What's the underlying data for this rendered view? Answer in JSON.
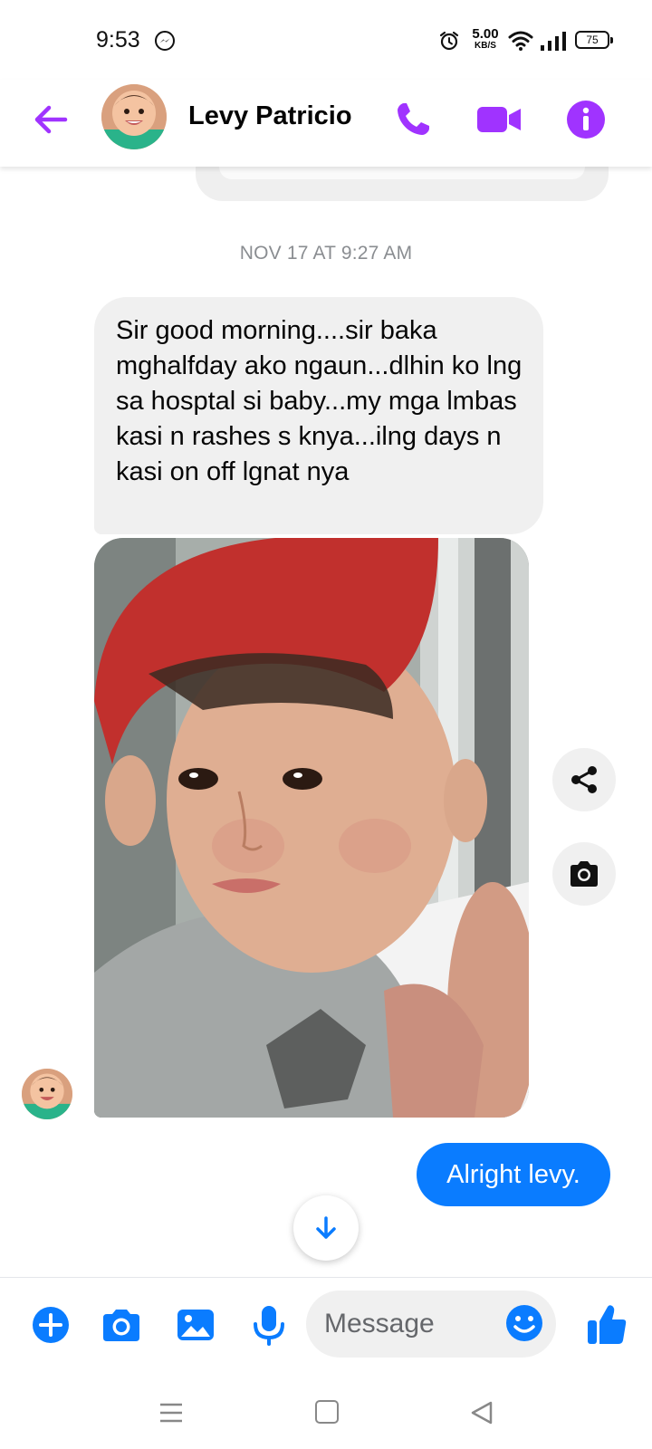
{
  "status_bar": {
    "time": "9:53",
    "net_speed_value": "5.00",
    "net_speed_unit": "KB/S",
    "battery": "75"
  },
  "header": {
    "contact_name": "Levy Patricio"
  },
  "conversation": {
    "timestamp": "NOV 17 AT 9:27 AM",
    "incoming_text": "Sir good morning....sir baka mghalfday ako ngaun...dlhin ko lng sa hosptal si baby...my mga lmbas kasi n rashes s knya...ilng days n kasi on off lgnat nya",
    "outgoing_text": "Alright levy."
  },
  "composer": {
    "placeholder": "Message"
  },
  "colors": {
    "accent_purple": "#a033ff",
    "messenger_blue": "#0a7cff",
    "bubble_gray": "#f0f0f0",
    "timestamp_gray": "#8a8d91"
  },
  "icons": {
    "header": [
      "back-arrow-icon",
      "phone-icon",
      "video-camera-icon",
      "info-icon"
    ],
    "side": [
      "share-icon",
      "camera-icon"
    ],
    "composer": [
      "plus-icon",
      "camera-icon",
      "gallery-icon",
      "microphone-icon",
      "emoji-icon",
      "thumbs-up-icon"
    ],
    "nav": [
      "menu-icon",
      "home-icon",
      "back-icon"
    ]
  }
}
